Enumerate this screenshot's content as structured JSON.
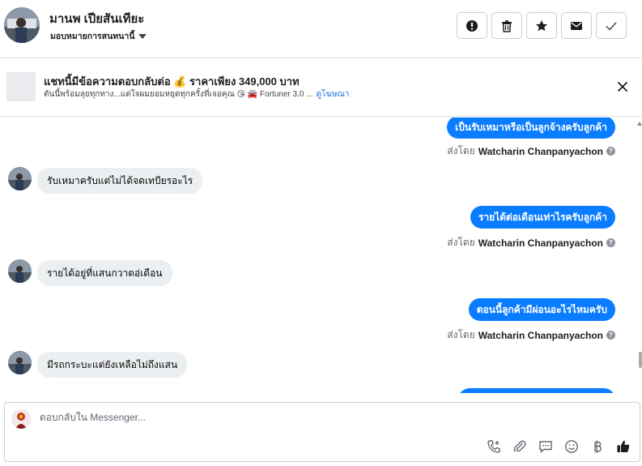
{
  "header": {
    "contact_name": "มานพ เปียสันเทียะ",
    "assign_label": "มอบหมายการสนทนานี้"
  },
  "ad_banner": {
    "title": "แชทนี้มีข้อความตอบกลับต่อ 💰 ราคาเพียง 349,000 บาท",
    "subtitle": "ตันนี้พร้อมลุยทุกทาง...แต่ใจผมยอมหยุดทุกครั้งที่เจอคุณ 😘 🚘 Fortuner 3.0 ...",
    "link": "ดูโฆษณา"
  },
  "messages": [
    {
      "direction": "out",
      "text": "เป็นรับเหมาหรือเป็นลูกจ้างครับลูกค้า",
      "sent_by_prefix": "ส่งโดย",
      "sender": "Watcharin Chanpanyachon"
    },
    {
      "direction": "in",
      "text": "รับเหมาครับแต่ไม่ได้จดเทบียรอะไร"
    },
    {
      "direction": "out",
      "text": "รายได้ต่อเดือนเท่าไรครับลูกค้า",
      "sent_by_prefix": "ส่งโดย",
      "sender": "Watcharin Chanpanyachon"
    },
    {
      "direction": "in",
      "text": "รายได้อยู่ที่แสนกวาตอ่เดือน"
    },
    {
      "direction": "out",
      "text": "ตอนนี้ลูกค้ามีผ่อนอะไรไหมครับ",
      "sent_by_prefix": "ส่งโดย",
      "sender": "Watcharin Chanpanyachon"
    },
    {
      "direction": "in",
      "text": "มีรถกระบะแต่ยังเหลือไม่ถึงแสน"
    }
  ],
  "composer": {
    "placeholder": "ตอบกลับใน Messenger..."
  },
  "icons": {
    "header_actions": [
      "alert-icon",
      "trash-icon",
      "star-icon",
      "envelope-icon",
      "check-icon"
    ],
    "composer_tools": [
      "call-add-icon",
      "paperclip-icon",
      "chat-bubble-icon",
      "smiley-icon",
      "baht-icon",
      "thumbs-up-icon"
    ]
  },
  "colors": {
    "accent": "#0a7cff",
    "incoming_bubble": "#eceff1",
    "link": "#216fdb"
  }
}
